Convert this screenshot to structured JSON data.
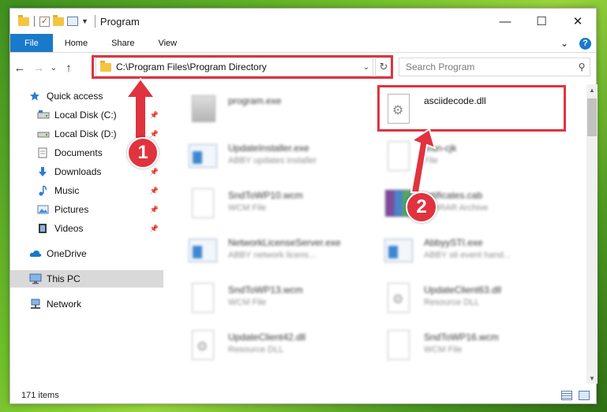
{
  "window": {
    "title": "Program",
    "controls": {
      "minimize": "—",
      "maximize": "☐",
      "close": "✕"
    }
  },
  "ribbon": {
    "tabs": [
      {
        "label": "File"
      },
      {
        "label": "Home"
      },
      {
        "label": "Share"
      },
      {
        "label": "View"
      }
    ],
    "expand_glyph": "⌄",
    "help_glyph": "?"
  },
  "address": {
    "path": "C:\\Program Files\\Program Directory",
    "dropdown_glyph": "⌄",
    "refresh_glyph": "↻"
  },
  "nav_buttons": {
    "back": "←",
    "forward": "→",
    "recent": "⌄",
    "up": "↑"
  },
  "search": {
    "placeholder": "Search Program",
    "icon_glyph": "⚲"
  },
  "sidebar": {
    "items": [
      {
        "label": "Quick access",
        "icon": "star-icon",
        "pinned": false
      },
      {
        "label": "Local Disk (C:)",
        "icon": "drive-icon",
        "pinned": true
      },
      {
        "label": "Local Disk (D:)",
        "icon": "drive-icon",
        "pinned": true
      },
      {
        "label": "Documents",
        "icon": "documents-icon",
        "pinned": true
      },
      {
        "label": "Downloads",
        "icon": "downloads-icon",
        "pinned": true
      },
      {
        "label": "Music",
        "icon": "music-icon",
        "pinned": true
      },
      {
        "label": "Pictures",
        "icon": "pictures-icon",
        "pinned": true
      },
      {
        "label": "Videos",
        "icon": "videos-icon",
        "pinned": true
      },
      {
        "label": "OneDrive",
        "icon": "cloud-icon",
        "pinned": false
      },
      {
        "label": "This PC",
        "icon": "computer-icon",
        "pinned": false,
        "selected": true
      },
      {
        "label": "Network",
        "icon": "network-icon",
        "pinned": false
      }
    ],
    "pin_glyph": "📌"
  },
  "files": [
    {
      "name": "program.exe",
      "desc": "",
      "icon": "program-icon",
      "blurred": true
    },
    {
      "name": "asciidecode.dll",
      "desc": "",
      "icon": "dll-icon",
      "blurred": false,
      "highlighted": true
    },
    {
      "name": "UpdateInstaller.exe",
      "desc": "ABBY updates installer",
      "icon": "exe-icon",
      "blurred": true
    },
    {
      "name": "lean-cjk",
      "desc": "File",
      "icon": "file-icon",
      "blurred": true
    },
    {
      "name": "SndToWP10.wcm",
      "desc": "WCM File",
      "icon": "file-icon",
      "blurred": true
    },
    {
      "name": "ertificates.cab",
      "desc": "WinRAR Archive",
      "icon": "archive-icon",
      "blurred": true
    },
    {
      "name": "NetworkLicenseServer.exe",
      "desc": "ABBY network licens...",
      "icon": "exe-icon",
      "blurred": true
    },
    {
      "name": "AbbyySTI.exe",
      "desc": "ABBY sti event hand...",
      "icon": "exe-icon",
      "blurred": true
    },
    {
      "name": "SndToWP13.wcm",
      "desc": "WCM File",
      "icon": "file-icon",
      "blurred": true
    },
    {
      "name": "UpdateClient63.dll",
      "desc": "Resource DLL",
      "icon": "dll-icon",
      "blurred": true
    },
    {
      "name": "UpdateClient42.dll",
      "desc": "Resource DLL",
      "icon": "dll-icon",
      "blurred": true
    },
    {
      "name": "SndToWP16.wcm",
      "desc": "WCM File",
      "icon": "file-icon",
      "blurred": true
    }
  ],
  "status": {
    "count": "171 items"
  },
  "callouts": [
    {
      "label": "1"
    },
    {
      "label": "2"
    }
  ],
  "colors": {
    "accent": "#1979ca",
    "highlight": "#e0333f",
    "selected": "#d9d9d9"
  }
}
